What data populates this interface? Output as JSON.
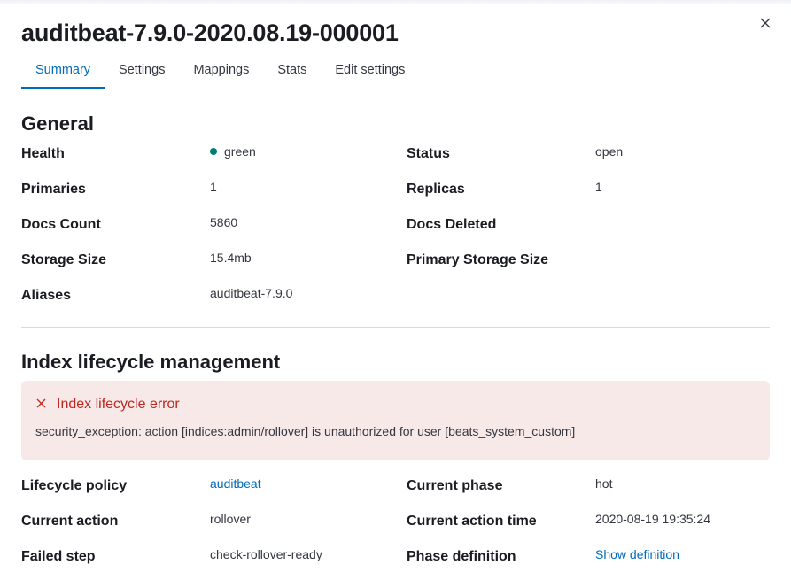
{
  "flyout": {
    "title": "auditbeat-7.9.0-2020.08.19-000001",
    "close_icon": "close-icon"
  },
  "tabs": [
    {
      "label": "Summary",
      "active": true
    },
    {
      "label": "Settings",
      "active": false
    },
    {
      "label": "Mappings",
      "active": false
    },
    {
      "label": "Stats",
      "active": false
    },
    {
      "label": "Edit settings",
      "active": false
    }
  ],
  "general": {
    "heading": "General",
    "health": {
      "label": "Health",
      "value": "green",
      "color": "#017d73"
    },
    "status": {
      "label": "Status",
      "value": "open"
    },
    "primaries": {
      "label": "Primaries",
      "value": "1"
    },
    "replicas": {
      "label": "Replicas",
      "value": "1"
    },
    "docs_count": {
      "label": "Docs Count",
      "value": "5860"
    },
    "docs_deleted": {
      "label": "Docs Deleted",
      "value": ""
    },
    "storage_size": {
      "label": "Storage Size",
      "value": "15.4mb"
    },
    "primary_storage_size": {
      "label": "Primary Storage Size",
      "value": ""
    },
    "aliases": {
      "label": "Aliases",
      "value": "auditbeat-7.9.0"
    }
  },
  "ilm": {
    "heading": "Index lifecycle management",
    "error": {
      "title": "Index lifecycle error",
      "icon": "cross-icon",
      "message": "security_exception: action [indices:admin/rollover] is unauthorized for user [beats_system_custom]"
    },
    "lifecycle_policy": {
      "label": "Lifecycle policy",
      "value": "auditbeat"
    },
    "current_phase": {
      "label": "Current phase",
      "value": "hot"
    },
    "current_action": {
      "label": "Current action",
      "value": "rollover"
    },
    "current_action_time": {
      "label": "Current action time",
      "value": "2020-08-19 19:35:24"
    },
    "failed_step": {
      "label": "Failed step",
      "value": "check-rollover-ready"
    },
    "phase_definition": {
      "label": "Phase definition",
      "value": "Show definition"
    }
  }
}
